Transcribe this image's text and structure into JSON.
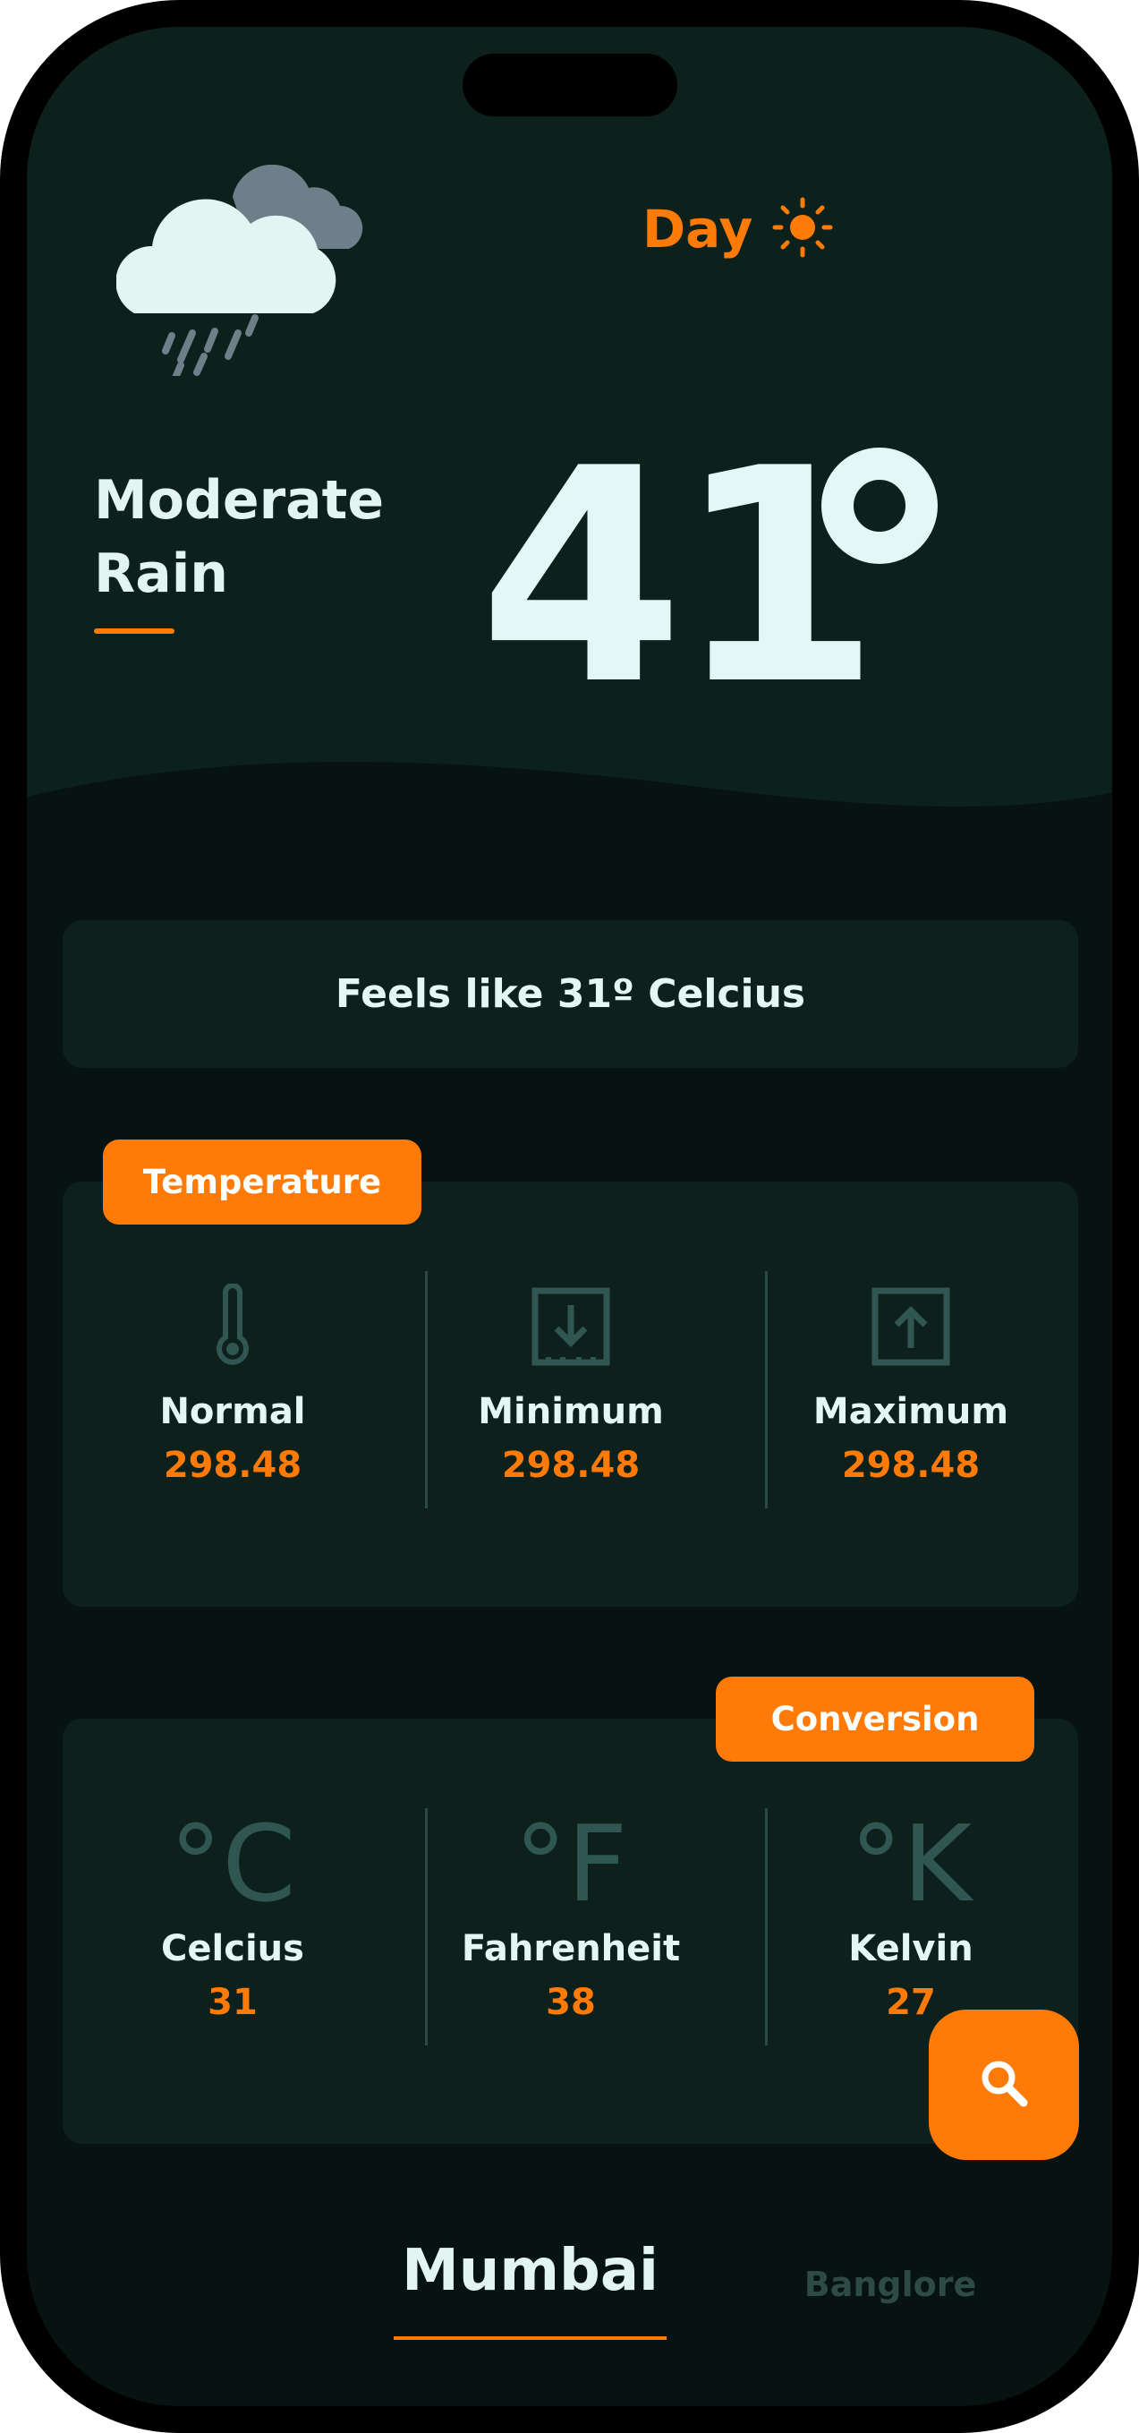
{
  "header": {
    "day_label": "Day",
    "weather_icon": "cloud-rain-icon",
    "day_icon": "sun-icon"
  },
  "current": {
    "condition": "Moderate Rain",
    "temperature": "41"
  },
  "feels_like": "Feels like 31º Celcius",
  "temperature_card": {
    "tag": "Temperature",
    "items": [
      {
        "label": "Normal",
        "value": "298.48",
        "icon": "thermometer-icon"
      },
      {
        "label": "Minimum",
        "value": "298.48",
        "icon": "arrow-down-box-icon"
      },
      {
        "label": "Maximum",
        "value": "298.48",
        "icon": "arrow-up-box-icon"
      }
    ]
  },
  "conversion_card": {
    "tag": "Conversion",
    "items": [
      {
        "glyph": "°C",
        "label": "Celcius",
        "value": "31"
      },
      {
        "glyph": "°F",
        "label": "Fahrenheit",
        "value": "38"
      },
      {
        "glyph": "°K",
        "label": "Kelvin",
        "value": "27"
      }
    ]
  },
  "cities": {
    "active": "Mumbai",
    "inactive": "Banglore"
  },
  "colors": {
    "accent": "#ff7a06",
    "background": "#061310",
    "card": "#0d201c",
    "text": "#e3f5f3"
  }
}
